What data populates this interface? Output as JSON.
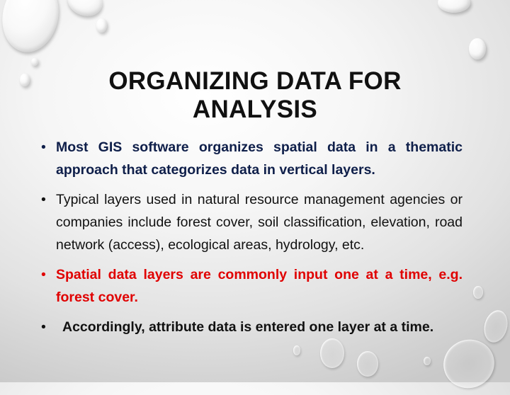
{
  "slide": {
    "title": "ORGANIZING DATA FOR ANALYSIS",
    "bullet_glyph": "•",
    "bullets": [
      {
        "text": "Most GIS software organizes spatial data in a thematic approach that categorizes data in vertical layers.",
        "color": "#0f1f4a",
        "bold": true
      },
      {
        "text": "Typical layers used in natural resource management agencies or companies include forest cover, soil classification, elevation, road network (access), ecological areas, hydrology, etc.",
        "color": "#111111",
        "bold": false
      },
      {
        "text": "Spatial data layers are commonly input one at a time, e.g. forest cover.",
        "color": "#e00000",
        "bold": true
      },
      {
        "text": "Accordingly, attribute data is entered one layer at a time.",
        "color": "#111111",
        "bold": true
      }
    ],
    "background": {
      "theme": "water-droplets",
      "gradient_from": "#ffffff",
      "gradient_to": "#c9c9c9"
    }
  }
}
